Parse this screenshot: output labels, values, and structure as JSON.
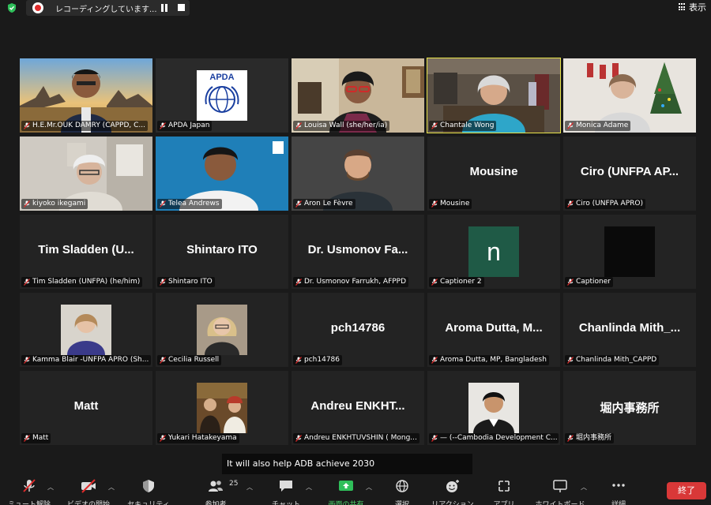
{
  "topbar": {
    "recording_text": "レコーディングしています...",
    "view_label": "表示"
  },
  "tiles": [
    {
      "name": "H.E.Mr.OUK DAMRY (CAPPD, C...",
      "big": "",
      "kind": "video-angkor"
    },
    {
      "name": "APDA Japan",
      "big": "",
      "kind": "logo-apda",
      "logo_text": "APDA"
    },
    {
      "name": "Louisa Wall (she/her/ia)",
      "big": "",
      "kind": "video-room-warm"
    },
    {
      "name": "Chantale Wong",
      "big": "",
      "kind": "video-office",
      "active": true
    },
    {
      "name": "Monica Adame",
      "big": "",
      "kind": "video-christmas"
    },
    {
      "name": "kiyoko ikegami",
      "big": "",
      "kind": "video-room-light"
    },
    {
      "name": "Telea Andrews",
      "big": "",
      "kind": "video-blue"
    },
    {
      "name": "Aron Le Fèvre",
      "big": "",
      "kind": "video-gray"
    },
    {
      "name": "Mousine",
      "big": "Mousine",
      "kind": "name"
    },
    {
      "name": "Ciro (UNFPA APRO)",
      "big": "Ciro (UNFPA AP...",
      "kind": "name"
    },
    {
      "name": "Tim Sladden (UNFPA) (he/him)",
      "big": "Tim Sladden (U...",
      "kind": "name"
    },
    {
      "name": "Shintaro ITO",
      "big": "Shintaro ITO",
      "kind": "name"
    },
    {
      "name": "Dr. Usmonov Farrukh, AFPPD",
      "big": "Dr. Usmonov Fa...",
      "kind": "name"
    },
    {
      "name": "Captioner 2",
      "big": "",
      "kind": "avatar-n",
      "avatar_letter": "n"
    },
    {
      "name": "Captioner",
      "big": "",
      "kind": "avatar-black"
    },
    {
      "name": "Kamma Blair -UNFPA APRO (Sh...",
      "big": "",
      "kind": "photo-woman"
    },
    {
      "name": "Cecilia Russell",
      "big": "",
      "kind": "photo-blonde"
    },
    {
      "name": "pch14786",
      "big": "pch14786",
      "kind": "name"
    },
    {
      "name": "Aroma Dutta, MP, Bangladesh",
      "big": "Aroma Dutta, M...",
      "kind": "name"
    },
    {
      "name": "Chanlinda Mith_CAPPD",
      "big": "Chanlinda Mith_...",
      "kind": "name"
    },
    {
      "name": "Matt",
      "big": "Matt",
      "kind": "name"
    },
    {
      "name": "Yukari Hatakeyama",
      "big": "",
      "kind": "photo-painting"
    },
    {
      "name": "Andreu ENKHTUVSHIN ( Mong...",
      "big": "Andreu ENKHT...",
      "kind": "name"
    },
    {
      "name": "— (--Cambodia Development C...",
      "big": "",
      "kind": "photo-man"
    },
    {
      "name": "堀内事務所",
      "big": "堀内事務所",
      "kind": "name"
    }
  ],
  "caption": "It will also help ADB achieve 2030",
  "toolbar": {
    "mute": "ミュート解除",
    "video": "ビデオの開始",
    "security": "セキュリティ",
    "participants": "参加者",
    "participants_count": "25",
    "chat": "チャット",
    "share": "画面の共有",
    "select": "選択",
    "reaction": "リアクション",
    "apps": "アプリ",
    "whiteboard": "ホワイトボード",
    "more": "詳細",
    "end": "終了"
  },
  "colors": {
    "active_border": "#e8e34a",
    "end_button": "#d93838",
    "share_green": "#4fd46b",
    "muted_red": "#e02b2b"
  }
}
